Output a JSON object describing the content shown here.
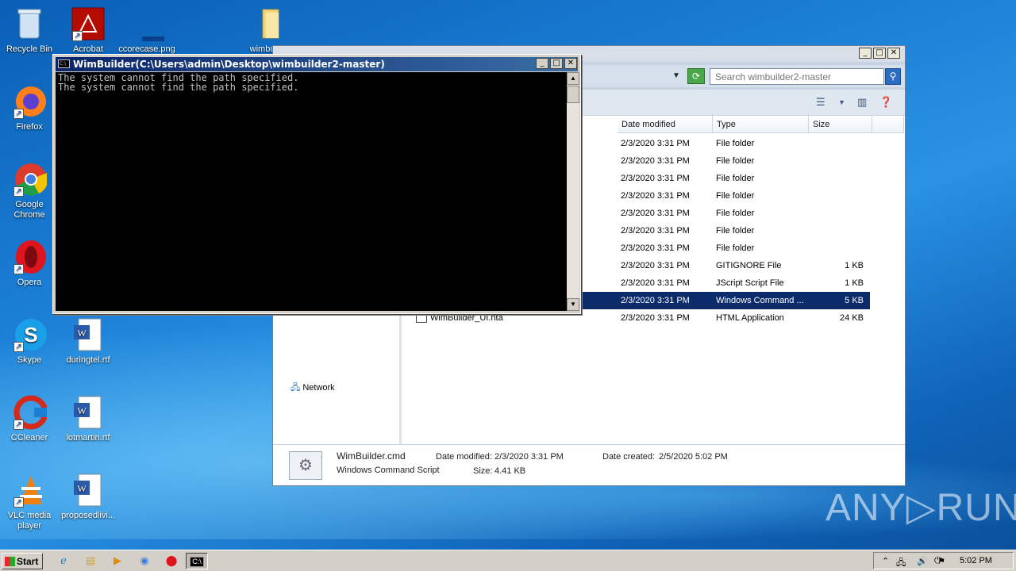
{
  "desktop": {
    "icons": [
      {
        "label": "Recycle Bin"
      },
      {
        "label": "Acrobat"
      },
      {
        "label": "ccorecase.png"
      },
      {
        "label": "wimbuil"
      },
      {
        "label": "Firefox"
      },
      {
        "label": "Google Chrome"
      },
      {
        "label": "Opera"
      },
      {
        "label": "Skype"
      },
      {
        "label": "duringtel.rtf"
      },
      {
        "label": "CCleaner"
      },
      {
        "label": "lotmartin.rtf"
      },
      {
        "label": "VLC media player"
      },
      {
        "label": "proposedlivi..."
      }
    ]
  },
  "explorer": {
    "search_placeholder": "Search wimbuilder2-master",
    "columns": {
      "date": "Date modified",
      "type": "Type",
      "size": "Size"
    },
    "rows": [
      {
        "name": "",
        "date": "2/3/2020 3:31 PM",
        "type": "File folder",
        "size": ""
      },
      {
        "name": "",
        "date": "2/3/2020 3:31 PM",
        "type": "File folder",
        "size": ""
      },
      {
        "name": "",
        "date": "2/3/2020 3:31 PM",
        "type": "File folder",
        "size": ""
      },
      {
        "name": "",
        "date": "2/3/2020 3:31 PM",
        "type": "File folder",
        "size": ""
      },
      {
        "name": "",
        "date": "2/3/2020 3:31 PM",
        "type": "File folder",
        "size": ""
      },
      {
        "name": "",
        "date": "2/3/2020 3:31 PM",
        "type": "File folder",
        "size": ""
      },
      {
        "name": "",
        "date": "2/3/2020 3:31 PM",
        "type": "File folder",
        "size": ""
      },
      {
        "name": "",
        "date": "2/3/2020 3:31 PM",
        "type": "GITIGNORE File",
        "size": "1 KB"
      },
      {
        "name": "",
        "date": "2/3/2020 3:31 PM",
        "type": "JScript Script File",
        "size": "1 KB"
      },
      {
        "name": "",
        "date": "2/3/2020 3:31 PM",
        "type": "Windows Command ...",
        "size": "5 KB"
      },
      {
        "name": "WimBuilder_UI.hta",
        "date": "2/3/2020 3:31 PM",
        "type": "HTML Application",
        "size": "24 KB"
      }
    ],
    "nav_network": "Network",
    "details": {
      "filename": "WimBuilder.cmd",
      "filetype": "Windows Command Script",
      "date_modified_label": "Date modified:",
      "date_modified": "2/3/2020 3:31 PM",
      "date_created_label": "Date created:",
      "date_created": "2/5/2020 5:02 PM",
      "size_label": "Size:",
      "size": "4.41 KB"
    }
  },
  "cmd": {
    "title": "WimBuilder(C:\\Users\\admin\\Desktop\\wimbuilder2-master)",
    "output": "The system cannot find the path specified.\nThe system cannot find the path specified."
  },
  "taskbar": {
    "start_label": "Start",
    "clock": "5:02 PM"
  },
  "watermark": "ANY▷RUN"
}
